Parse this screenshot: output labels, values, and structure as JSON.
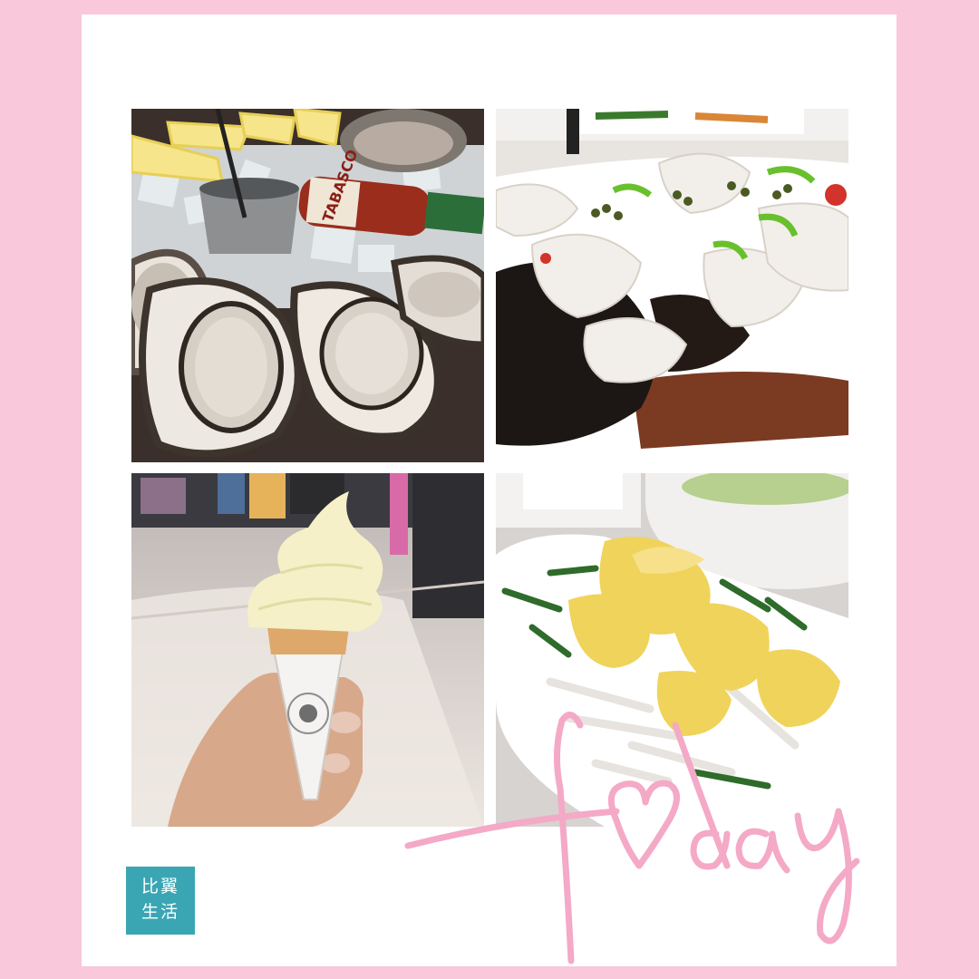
{
  "background_color": "#f9c8da",
  "card_color": "#ffffff",
  "photos": [
    {
      "subject": "oysters on ice with lemon, Tabasco bottle and a sauce cup",
      "label": "TABASCO"
    },
    {
      "subject": "steamed sliced fish with black fungus and green chilies",
      "label": ""
    },
    {
      "subject": "hand holding a soft-serve ice cream cone in a mall",
      "label": ""
    },
    {
      "subject": "scrambled egg with crab meat and chives on a white plate",
      "label": ""
    }
  ],
  "logo": {
    "line1": "比翼",
    "line2": "生活",
    "color": "#3aa6b4"
  },
  "script_text": "Today",
  "script_color": "#f4a9c6"
}
